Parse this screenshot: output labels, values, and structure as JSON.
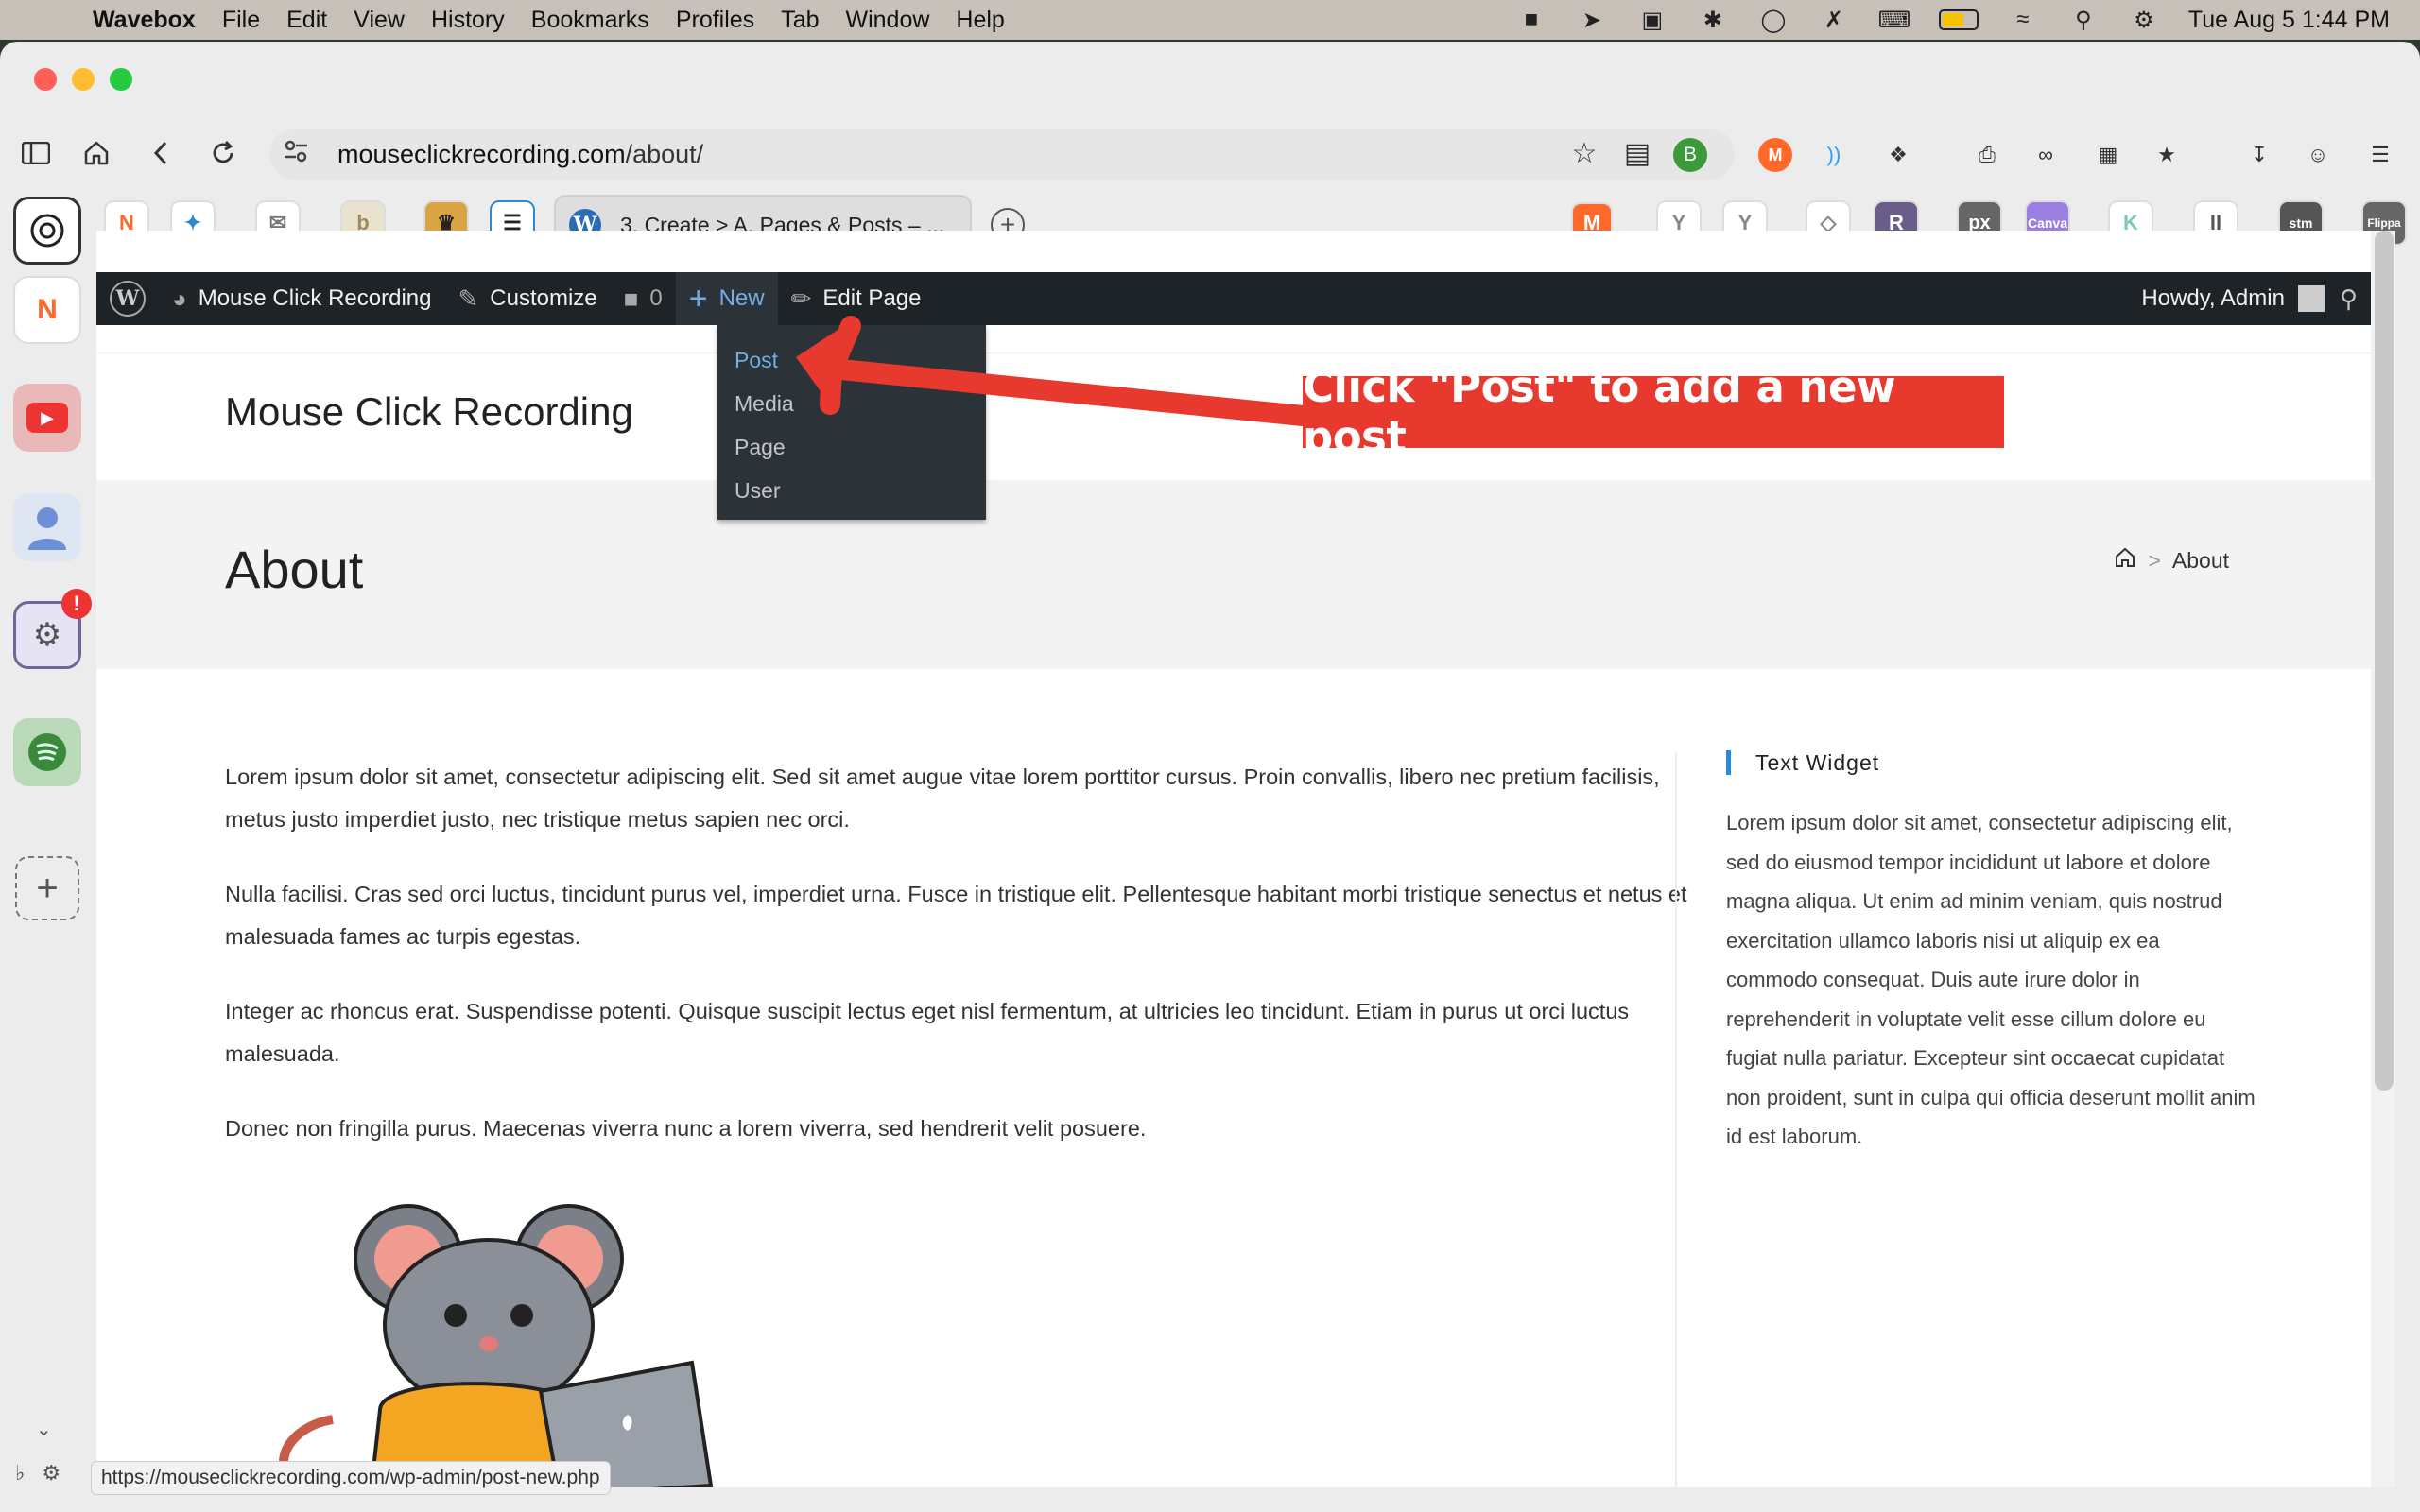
{
  "menubar": {
    "app": "Wavebox",
    "items": [
      "File",
      "Edit",
      "View",
      "History",
      "Bookmarks",
      "Profiles",
      "Tab",
      "Window",
      "Help"
    ],
    "clock": "Tue Aug 5  1:44 PM"
  },
  "browser": {
    "url_host": "mouseclickrecording.com",
    "url_path": "/about/",
    "profile_badge": "B",
    "active_tab_title": "3. Create > A. Pages & Posts – ...",
    "status_url": "https://mouseclickrecording.com/wp-admin/post-new.php"
  },
  "adminbar": {
    "site_name": "Mouse Click Recording",
    "customize": "Customize",
    "comments_count": "0",
    "new_label": "New",
    "edit_page": "Edit Page",
    "howdy": "Howdy, Admin"
  },
  "new_menu": {
    "items": [
      "Post",
      "Media",
      "Page",
      "User"
    ]
  },
  "site": {
    "title": "Mouse Click Recording",
    "page_title": "About",
    "breadcrumb_current": "About",
    "breadcrumb_sep": ">"
  },
  "content": {
    "paragraphs": [
      "Lorem ipsum dolor sit amet, consectetur adipiscing elit. Sed sit amet augue vitae lorem porttitor cursus. Proin convallis, libero nec pretium facilisis, metus justo imperdiet justo, nec tristique metus sapien nec orci.",
      "Nulla facilisi. Cras sed orci luctus, tincidunt purus vel, imperdiet urna. Fusce in tristique elit. Pellentesque habitant morbi tristique senectus et netus et malesuada fames ac turpis egestas.",
      "Integer ac rhoncus erat. Suspendisse potenti. Quisque suscipit lectus eget nisl fermentum, at ultricies leo tincidunt. Etiam in purus ut orci luctus malesuada.",
      "Donec non fringilla purus. Maecenas viverra nunc a lorem viverra, sed hendrerit velit posuere."
    ]
  },
  "widget": {
    "title": "Text Widget",
    "body": "Lorem ipsum dolor sit amet, consectetur adipiscing elit, sed do eiusmod tempor incididunt ut labore et dolore magna aliqua. Ut enim ad minim veniam, quis nostrud exercitation ullamco laboris nisi ut aliquip ex ea commodo consequat. Duis aute irure dolor in reprehenderit in voluptate velit esse cillum dolore eu fugiat nulla pariatur. Excepteur sint occaecat cupidatat non proident, sunt in culpa qui officia deserunt mollit anim id est laborum."
  },
  "annotation": {
    "text": "Click \"Post\" to add a new post"
  },
  "colors": {
    "wp_adminbar": "#1d2327",
    "wp_link_blue": "#72aee6",
    "annotation_red": "#e8392f",
    "widget_accent": "#2a8ad6"
  }
}
